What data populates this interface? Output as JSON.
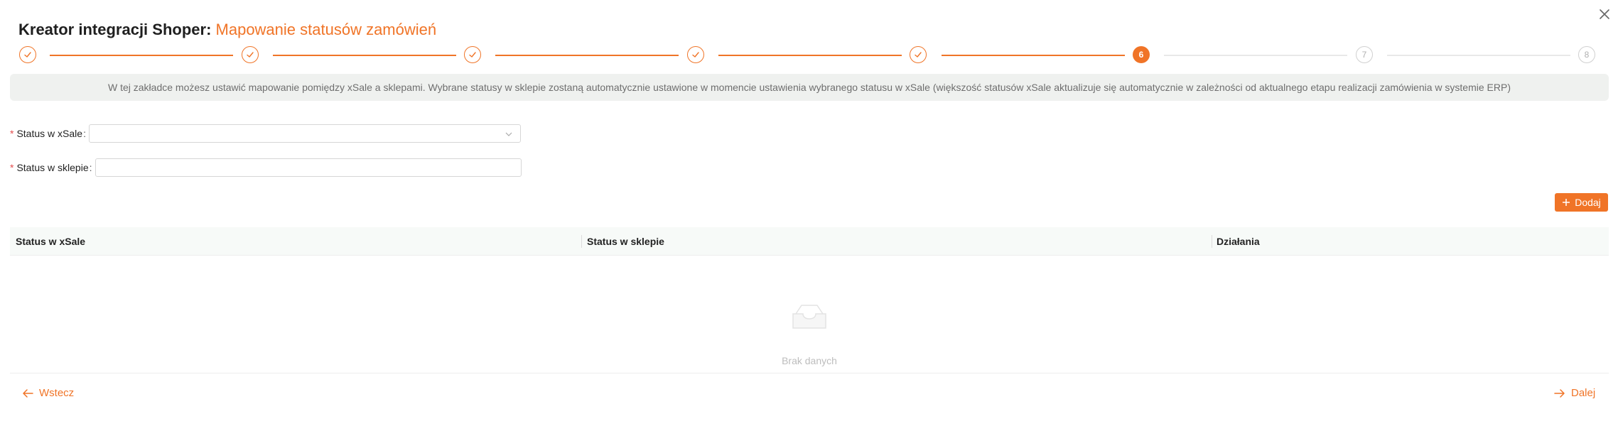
{
  "header": {
    "title_prefix": "Kreator integracji Shoper:",
    "title_sub": "Mapowanie statusów zamówień",
    "close_icon": "close-icon"
  },
  "stepper": {
    "steps": [
      {
        "state": "done",
        "label": ""
      },
      {
        "state": "done",
        "label": ""
      },
      {
        "state": "done",
        "label": ""
      },
      {
        "state": "done",
        "label": ""
      },
      {
        "state": "done",
        "label": ""
      },
      {
        "state": "active",
        "label": "6"
      },
      {
        "state": "pending",
        "label": "7"
      },
      {
        "state": "pending",
        "label": "8"
      }
    ],
    "current": 6,
    "total": 8
  },
  "info": {
    "text": "W tej zakładce możesz ustawić mapowanie pomiędzy xSale a sklepami. Wybrane statusy w sklepie zostaną automatycznie ustawione w momencie ustawienia wybranego statusu w xSale (większość statusów xSale aktualizuje się automatycznie w zależności od aktualnego etapu realizacji zamówienia w systemie ERP)"
  },
  "form": {
    "required_mark": "*",
    "xsale_status": {
      "label": "Status w xSale",
      "colon": ":",
      "value": ""
    },
    "shop_status": {
      "label": "Status w sklepie",
      "colon": ":",
      "value": ""
    }
  },
  "add_button": {
    "label": "Dodaj",
    "icon": "plus-icon"
  },
  "table": {
    "columns": [
      "Status w xSale",
      "Status w sklepie",
      "Działania"
    ],
    "rows": [],
    "empty_text": "Brak danych"
  },
  "footer": {
    "back_label": "Wstecz",
    "next_label": "Dalej"
  },
  "colors": {
    "accent": "#f07427",
    "info_bg": "#eff1ef",
    "required": "#e34d4d"
  }
}
